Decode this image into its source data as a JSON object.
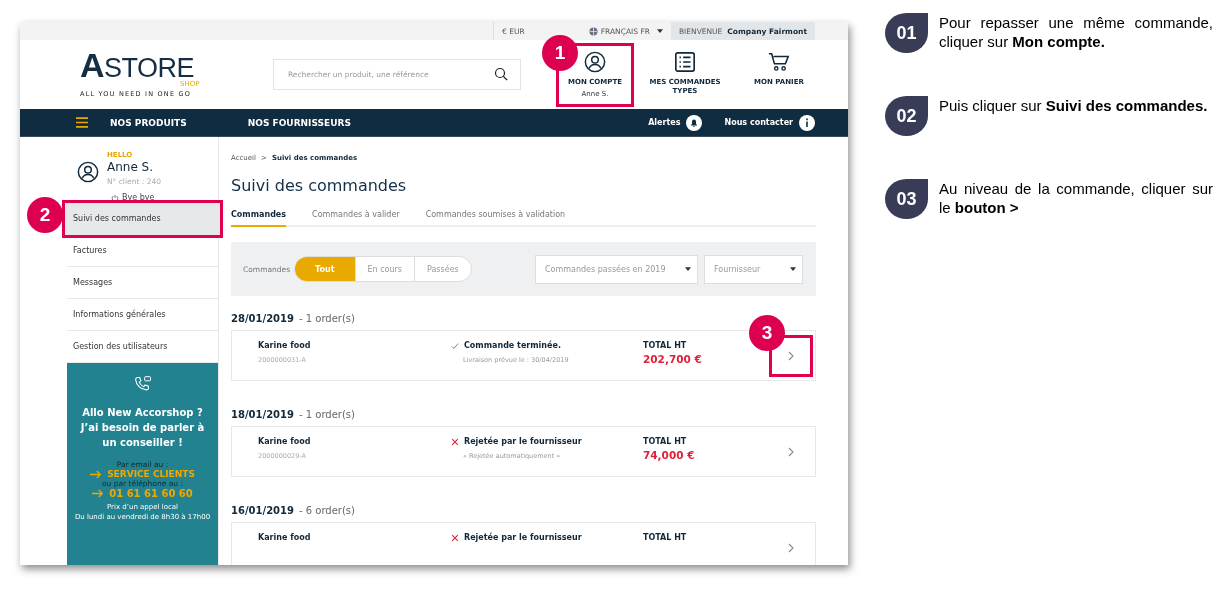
{
  "top_bar": {
    "currency": "€ EUR",
    "language": "FRANÇAIS FR",
    "welcome_label": "BIENVENUE",
    "welcome_name": "Company Fairmont"
  },
  "header": {
    "logo": {
      "name": "ASTORE",
      "sub": "SHOP",
      "tagline": "ALL YOU NEED IN ONE GO"
    },
    "search": {
      "placeholder": "Rechercher un produit, une référence"
    },
    "links": [
      {
        "kind": "account",
        "label": "MON COMPTE",
        "sub": "Anne S.",
        "callout": "1"
      },
      {
        "kind": "list",
        "label": "MES COMMANDES TYPES"
      },
      {
        "kind": "cart",
        "label": "MON PANIER"
      }
    ]
  },
  "nav": {
    "items": [
      "NOS PRODUITS",
      "NOS FOURNISSEURS"
    ],
    "right": [
      {
        "kind": "bell",
        "label": "Alertes"
      },
      {
        "kind": "info",
        "label": "Nous contacter"
      }
    ]
  },
  "sidebar": {
    "greeting": "HELLO",
    "name": "Anne S.",
    "client": "N° client : 240",
    "logout": "Bye bye",
    "items": [
      {
        "label": "Suivi des commandes",
        "selected": true,
        "callout": "2"
      },
      {
        "label": "Factures",
        "selected": false
      },
      {
        "label": "Messages",
        "selected": false
      },
      {
        "label": "Informations générales",
        "selected": false
      },
      {
        "label": "Gestion des utilisateurs",
        "selected": false
      }
    ],
    "help": {
      "title": "Allo New Accorshop ? J’ai besoin de parler à un conseiller !",
      "email_label": "Par email au :",
      "email_link": "SERVICE CLIENTS",
      "phone_label": "ou par téléphone au :",
      "phone": "01 61 61 60 60",
      "note": "Prix d’un appel local",
      "hours": "Du lundi au vendredi de 8h30 à 17h00"
    }
  },
  "content": {
    "breadcrumb": [
      {
        "label": "Accueil",
        "current": false
      },
      {
        "label": "Suivi des commandes",
        "current": true
      }
    ],
    "breadcrumb_separator": ">",
    "title": "Suivi des commandes",
    "tabs": [
      {
        "label": "Commandes",
        "selected": true
      },
      {
        "label": "Commandes à valider",
        "selected": false
      },
      {
        "label": "Commandes soumises à validation",
        "selected": false
      }
    ],
    "filter": {
      "label": "Commandes",
      "segments": [
        {
          "label": "Tout",
          "selected": true
        },
        {
          "label": "En cours",
          "selected": false
        },
        {
          "label": "Passées",
          "selected": false
        }
      ],
      "selects": [
        "Commandes passées en 2019",
        "Fournisseur"
      ]
    },
    "groups": [
      {
        "date": "28/01/2019",
        "count": "- 1 order(s)",
        "orders": [
          {
            "supplier": "Karine food",
            "number": "2000000031-A",
            "kind": "done",
            "status": "Commande terminée.",
            "detail": "Livraison prévue le : 30/04/2019",
            "total_label": "TOTAL HT",
            "total": "202,700 €",
            "callout": "3"
          }
        ]
      },
      {
        "date": "18/01/2019",
        "count": "- 1 order(s)",
        "orders": [
          {
            "supplier": "Karine food",
            "number": "2000000029-A",
            "kind": "rejected",
            "status": "Rejetée par le fournisseur",
            "detail": "« Rejetée automatiquement »",
            "total_label": "TOTAL HT",
            "total": "74,000 €"
          }
        ]
      },
      {
        "date": "16/01/2019",
        "count": "- 6 order(s)",
        "orders": [
          {
            "supplier": "Karine food",
            "kind": "rejected",
            "status": "Rejetée par le fournisseur",
            "total_label": "TOTAL HT"
          }
        ]
      }
    ]
  },
  "steps": [
    {
      "number": "01",
      "text": "Pour repasser une même commande, cliquer sur **Mon compte.**"
    },
    {
      "number": "02",
      "text": "Puis cliquer sur **Suivi des commandes.**"
    },
    {
      "number": "03",
      "text": "Au niveau de la commande, cliquer sur le **bouton >**"
    }
  ]
}
